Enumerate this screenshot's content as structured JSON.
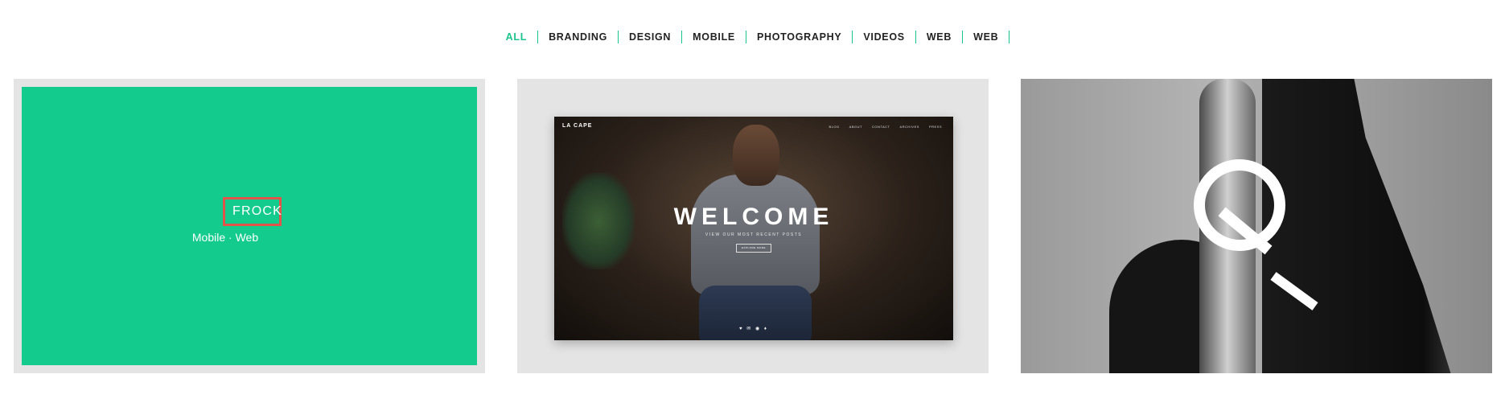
{
  "filters": [
    {
      "label": "ALL",
      "active": true
    },
    {
      "label": "BRANDING",
      "active": false
    },
    {
      "label": "DESIGN",
      "active": false
    },
    {
      "label": "MOBILE",
      "active": false
    },
    {
      "label": "PHOTOGRAPHY",
      "active": false
    },
    {
      "label": "VIDEOS",
      "active": false
    },
    {
      "label": "WEB",
      "active": false
    },
    {
      "label": "WEB",
      "active": false
    }
  ],
  "colors": {
    "accent": "#1ac48b",
    "overlay": "#12cb8c",
    "highlight": "#e2534a"
  },
  "portfolio": {
    "items": [
      {
        "title": "FROCK",
        "subtitle": "Mobile · Web"
      },
      {
        "mockup": {
          "brand": "LA CAPE",
          "nav": [
            "BLOG",
            "ABOUT",
            "CONTACT",
            "ARCHIVES",
            "PRESS"
          ],
          "heading": "WELCOME",
          "tagline": "VIEW OUR MOST RECENT POSTS",
          "cta": "EXPLORE MORE",
          "social": "♥ ✉ ◉ ♦"
        }
      },
      {
        "image": "q-portrait"
      }
    ]
  }
}
